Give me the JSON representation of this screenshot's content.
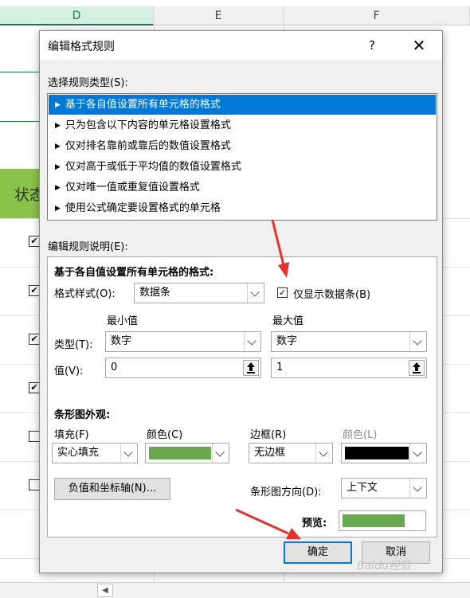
{
  "sheet": {
    "columns": [
      "D",
      "E",
      "F"
    ],
    "green_cell_text": "状态",
    "checkbox_marks": [
      "✔",
      "✔",
      "✔",
      "✔",
      "",
      ""
    ]
  },
  "dialog": {
    "title": "编辑格式规则",
    "help_label": "?",
    "close_label": "✕",
    "rule_type_label": "选择规则类型(S):",
    "rule_types": [
      "基于各自值设置所有单元格的格式",
      "只为包含以下内容的单元格设置格式",
      "仅对排名靠前或靠后的数值设置格式",
      "仅对高于或低于平均值的数值设置格式",
      "仅对唯一值或重复值设置格式",
      "使用公式确定要设置格式的单元格"
    ],
    "rule_desc_label": "编辑规则说明(E):",
    "section_title": "基于各自值设置所有单元格的格式:",
    "format_style_label": "格式样式(O):",
    "format_style_value": "数据条",
    "show_bar_only_label": "仅显示数据条(B)",
    "show_bar_only_checked": "✓",
    "min_header": "最小值",
    "max_header": "最大值",
    "type_label": "类型(T):",
    "min_type": "数字",
    "max_type": "数字",
    "value_label": "值(V):",
    "min_value": "0",
    "max_value": "1",
    "bar_appearance_label": "条形图外观:",
    "fill_label": "填充(F)",
    "fill_value": "实心填充",
    "fill_color_label": "颜色(C)",
    "fill_color": "#6aa84f",
    "border_label": "边框(R)",
    "border_value": "无边框",
    "border_color_label": "颜色(L)",
    "border_color": "#000000",
    "neg_axis_button": "负值和坐标轴(N)...",
    "bar_dir_label": "条形图方向(D):",
    "bar_dir_value": "上下文",
    "preview_label": "预览:",
    "ok_label": "确定",
    "cancel_label": "取消"
  },
  "accent_color": "#0078d7",
  "annotation_color": "#e8302c",
  "watermark": "Baidu经验"
}
